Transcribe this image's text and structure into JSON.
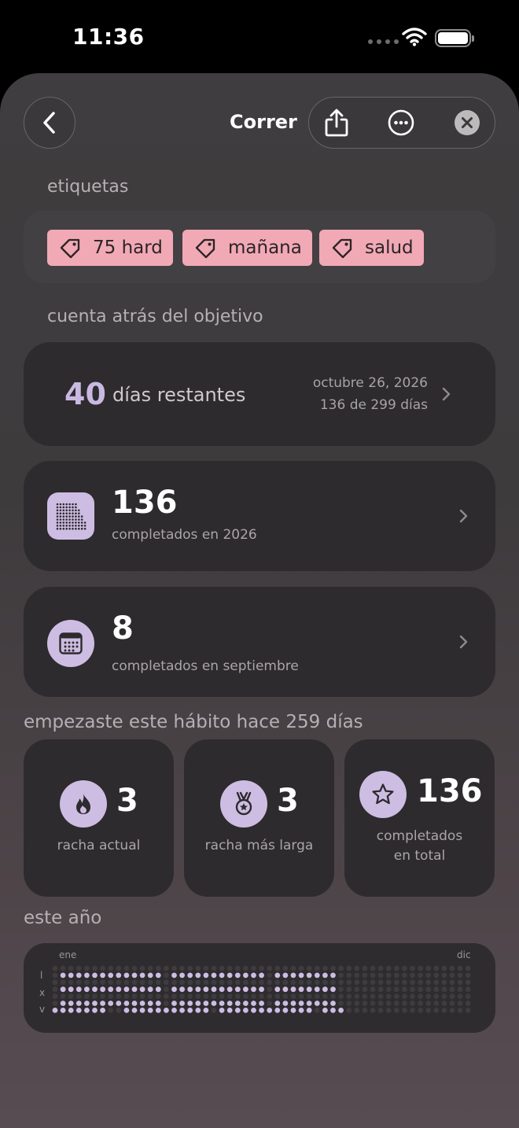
{
  "status_bar": {
    "time": "11:36"
  },
  "header": {
    "title": "Correr"
  },
  "tags_section": {
    "heading": "etiquetas",
    "tags": [
      {
        "label": "75 hard"
      },
      {
        "label": "mañana"
      },
      {
        "label": "salud"
      }
    ]
  },
  "countdown": {
    "heading": "cuenta atrás del objetivo",
    "days": "40",
    "days_label": "días restantes",
    "target_date": "octubre 26, 2026",
    "progress_text": "136 de 299 días"
  },
  "year_card": {
    "value": "136",
    "label": "completados en 2026"
  },
  "month_card": {
    "value": "8",
    "label": "completados en septiembre"
  },
  "started_heading": "empezaste este hábito hace 259 días",
  "stats": [
    {
      "value": "3",
      "label": "racha actual",
      "icon": "flame-icon"
    },
    {
      "value": "3",
      "label": "racha más larga",
      "icon": "medal-icon"
    },
    {
      "value": "136",
      "label_line1": "completados",
      "label_line2": "en total",
      "icon": "star-icon"
    }
  ],
  "this_year": {
    "heading": "este año",
    "month_start": "ene",
    "month_end": "dic",
    "weekday_labels": [
      "l",
      "x",
      "v"
    ]
  },
  "colors": {
    "accent": "#cdbde3",
    "tag": "#f1a9b5",
    "card": "#2d2b2d"
  }
}
